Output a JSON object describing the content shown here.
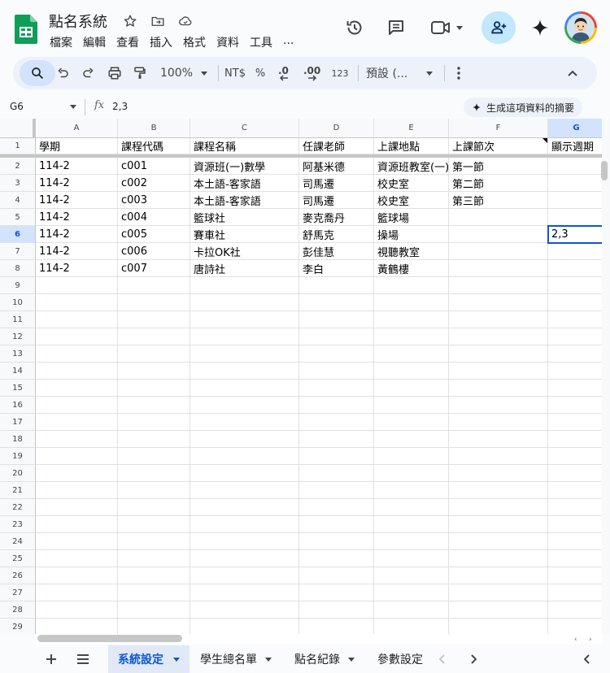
{
  "doc": {
    "title": "點名系統"
  },
  "menu": [
    "檔案",
    "編輯",
    "查看",
    "插入",
    "格式",
    "資料",
    "工具",
    "..."
  ],
  "toolbar": {
    "zoom": "100%",
    "currency": "NT$",
    "percent": "%",
    "dec_decrease": ".0",
    "dec_increase": ".00",
    "number_format": "123",
    "font": "預設 (..."
  },
  "formula_bar": {
    "cell_ref": "G6",
    "fx": "fx",
    "value": "2,3",
    "summary_button": "生成這項資料的摘要"
  },
  "columns": [
    "A",
    "B",
    "C",
    "D",
    "E",
    "F",
    "G"
  ],
  "selected_column": "G",
  "selected_row": "6",
  "rows": [
    {
      "n": "1",
      "cells": [
        "學期",
        "課程代碼",
        "課程名稱",
        "任課老師",
        "上課地點",
        "上課節次",
        "顯示週期"
      ]
    },
    {
      "n": "2",
      "cells": [
        "114-2",
        "c001",
        "資源班(一)數學",
        "阿基米德",
        "資源班教室(一)",
        "第一節",
        ""
      ]
    },
    {
      "n": "3",
      "cells": [
        "114-2",
        "c002",
        "本土語-客家語",
        "司馬遷",
        "校史室",
        "第二節",
        ""
      ]
    },
    {
      "n": "4",
      "cells": [
        "114-2",
        "c003",
        "本土語-客家語",
        "司馬遷",
        "校史室",
        "第三節",
        ""
      ]
    },
    {
      "n": "5",
      "cells": [
        "114-2",
        "c004",
        "籃球社",
        "麥克喬丹",
        "籃球場",
        "",
        ""
      ]
    },
    {
      "n": "6",
      "cells": [
        "114-2",
        "c005",
        "賽車社",
        "舒馬克",
        "操場",
        "",
        "2,3"
      ]
    },
    {
      "n": "7",
      "cells": [
        "114-2",
        "c006",
        "卡拉OK社",
        "彭佳慧",
        "視聽教室",
        "",
        ""
      ]
    },
    {
      "n": "8",
      "cells": [
        "114-2",
        "c007",
        "唐詩社",
        "李白",
        "黃鶴樓",
        "",
        ""
      ]
    },
    {
      "n": "9",
      "cells": [
        "",
        "",
        "",
        "",
        "",
        "",
        ""
      ]
    },
    {
      "n": "10",
      "cells": [
        "",
        "",
        "",
        "",
        "",
        "",
        ""
      ]
    },
    {
      "n": "11",
      "cells": [
        "",
        "",
        "",
        "",
        "",
        "",
        ""
      ]
    },
    {
      "n": "12",
      "cells": [
        "",
        "",
        "",
        "",
        "",
        "",
        ""
      ]
    },
    {
      "n": "13",
      "cells": [
        "",
        "",
        "",
        "",
        "",
        "",
        ""
      ]
    },
    {
      "n": "14",
      "cells": [
        "",
        "",
        "",
        "",
        "",
        "",
        ""
      ]
    },
    {
      "n": "15",
      "cells": [
        "",
        "",
        "",
        "",
        "",
        "",
        ""
      ]
    },
    {
      "n": "16",
      "cells": [
        "",
        "",
        "",
        "",
        "",
        "",
        ""
      ]
    },
    {
      "n": "17",
      "cells": [
        "",
        "",
        "",
        "",
        "",
        "",
        ""
      ]
    },
    {
      "n": "18",
      "cells": [
        "",
        "",
        "",
        "",
        "",
        "",
        ""
      ]
    },
    {
      "n": "19",
      "cells": [
        "",
        "",
        "",
        "",
        "",
        "",
        ""
      ]
    },
    {
      "n": "20",
      "cells": [
        "",
        "",
        "",
        "",
        "",
        "",
        ""
      ]
    },
    {
      "n": "21",
      "cells": [
        "",
        "",
        "",
        "",
        "",
        "",
        ""
      ]
    },
    {
      "n": "22",
      "cells": [
        "",
        "",
        "",
        "",
        "",
        "",
        ""
      ]
    },
    {
      "n": "23",
      "cells": [
        "",
        "",
        "",
        "",
        "",
        "",
        ""
      ]
    },
    {
      "n": "24",
      "cells": [
        "",
        "",
        "",
        "",
        "",
        "",
        ""
      ]
    },
    {
      "n": "25",
      "cells": [
        "",
        "",
        "",
        "",
        "",
        "",
        ""
      ]
    },
    {
      "n": "26",
      "cells": [
        "",
        "",
        "",
        "",
        "",
        "",
        ""
      ]
    },
    {
      "n": "27",
      "cells": [
        "",
        "",
        "",
        "",
        "",
        "",
        ""
      ]
    },
    {
      "n": "28",
      "cells": [
        "",
        "",
        "",
        "",
        "",
        "",
        ""
      ]
    },
    {
      "n": "29",
      "cells": [
        "",
        "",
        "",
        "",
        "",
        "",
        ""
      ]
    }
  ],
  "sheets": [
    {
      "name": "系統設定",
      "active": true
    },
    {
      "name": "學生總名單",
      "active": false
    },
    {
      "name": "點名紀錄",
      "active": false
    },
    {
      "name": "參數設定",
      "active": false
    }
  ],
  "colors": {
    "accent": "#0b57d0",
    "selection": "#d3e3fd",
    "share": "#c2e7ff",
    "sheets_green": "#0f9d58"
  }
}
